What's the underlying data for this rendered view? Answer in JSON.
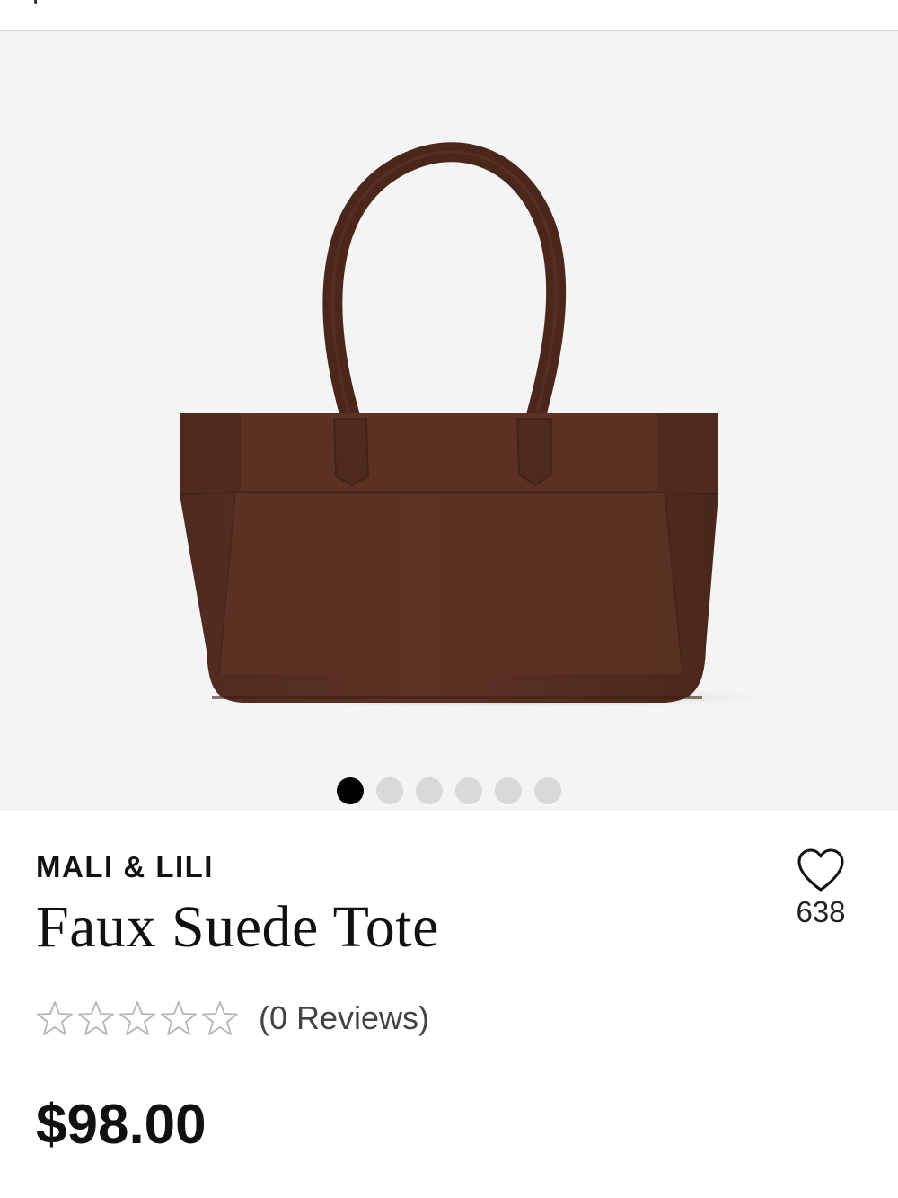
{
  "colors": {
    "gallery_bg": "#f4f4f4",
    "bag_brown": "#5a2f22",
    "dot_active": "#000000",
    "dot_inactive": "#d9d9d9"
  },
  "gallery": {
    "image_alt": "Faux Suede Tote",
    "dots": [
      {
        "active": true
      },
      {
        "active": false
      },
      {
        "active": false
      },
      {
        "active": false
      },
      {
        "active": false
      },
      {
        "active": false
      }
    ]
  },
  "product": {
    "brand": "MALI & LILI",
    "title": "Faux Suede Tote",
    "favorite_count": "638",
    "rating": 0,
    "rating_max": 5,
    "reviews_label": "(0 Reviews)",
    "price": "$98.00"
  },
  "icons": {
    "favorite": "heart-outline-icon",
    "star": "star-outline-icon"
  }
}
